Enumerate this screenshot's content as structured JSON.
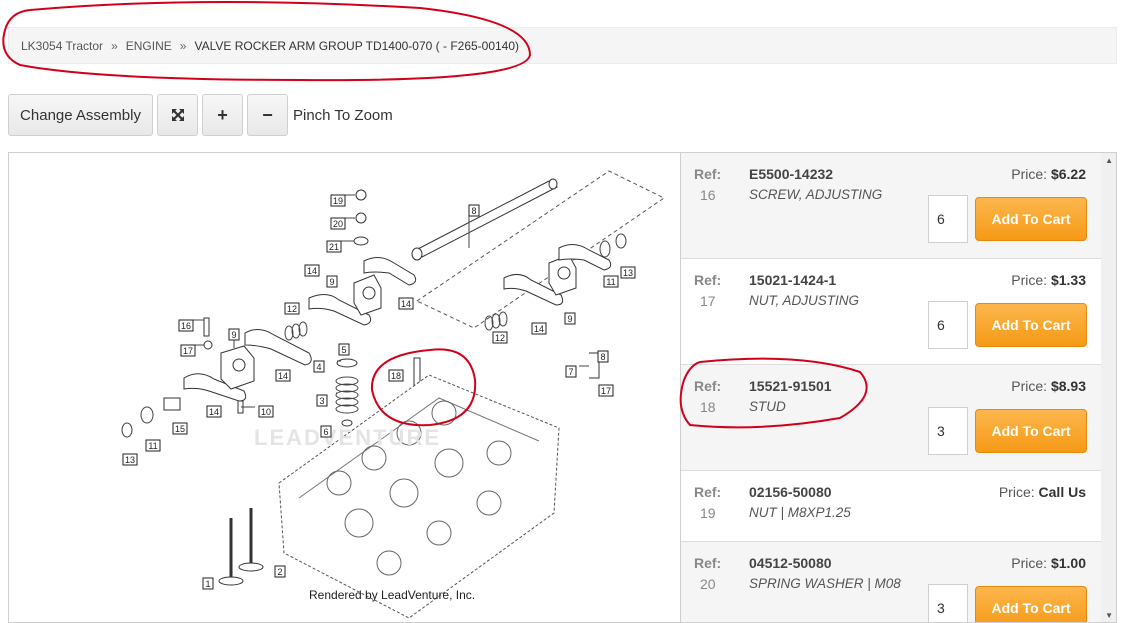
{
  "breadcrumb": {
    "items": [
      "LK3054 Tractor",
      "ENGINE"
    ],
    "separator": "»",
    "current": "VALVE ROCKER ARM GROUP TD1400-070 ( - F265-00140)"
  },
  "toolbar": {
    "change_assembly": "Change Assembly",
    "fit_icon": "⤧",
    "zoom_in": "+",
    "zoom_out": "−",
    "pinch_label": "Pinch To Zoom"
  },
  "diagram": {
    "rendered_by": "Rendered by LeadVenture, Inc.",
    "watermark": "LEADVENTURE",
    "callouts": [
      "1",
      "2",
      "3",
      "4",
      "5",
      "6",
      "7",
      "8",
      "8",
      "9",
      "9",
      "9",
      "10",
      "11",
      "11",
      "12",
      "12",
      "13",
      "13",
      "14",
      "14",
      "14",
      "14",
      "14",
      "15",
      "16",
      "17",
      "17",
      "18",
      "19",
      "20",
      "21"
    ]
  },
  "parts": [
    {
      "ref_label": "Ref:",
      "ref": "16",
      "part_no": "E5500-14232",
      "desc": "SCREW, ADJUSTING",
      "price_label": "Price:",
      "price": "$6.22",
      "qty": "6",
      "button": "Add To Cart"
    },
    {
      "ref_label": "Ref:",
      "ref": "17",
      "part_no": "15021-1424-1",
      "desc": "NUT, ADJUSTING",
      "price_label": "Price:",
      "price": "$1.33",
      "qty": "6",
      "button": "Add To Cart"
    },
    {
      "ref_label": "Ref:",
      "ref": "18",
      "part_no": "15521-91501",
      "desc": "STUD",
      "price_label": "Price:",
      "price": "$8.93",
      "qty": "3",
      "button": "Add To Cart"
    },
    {
      "ref_label": "Ref:",
      "ref": "19",
      "part_no": "02156-50080",
      "desc": "NUT | M8XP1.25",
      "price_label": "Price:",
      "price": "Call Us"
    },
    {
      "ref_label": "Ref:",
      "ref": "20",
      "part_no": "04512-50080",
      "desc": "SPRING WASHER | M08",
      "price_label": "Price:",
      "price": "$1.00",
      "qty": "3",
      "button": "Add To Cart"
    }
  ],
  "colors": {
    "accent": "#f7a21f",
    "annotation": "#d0021b"
  }
}
